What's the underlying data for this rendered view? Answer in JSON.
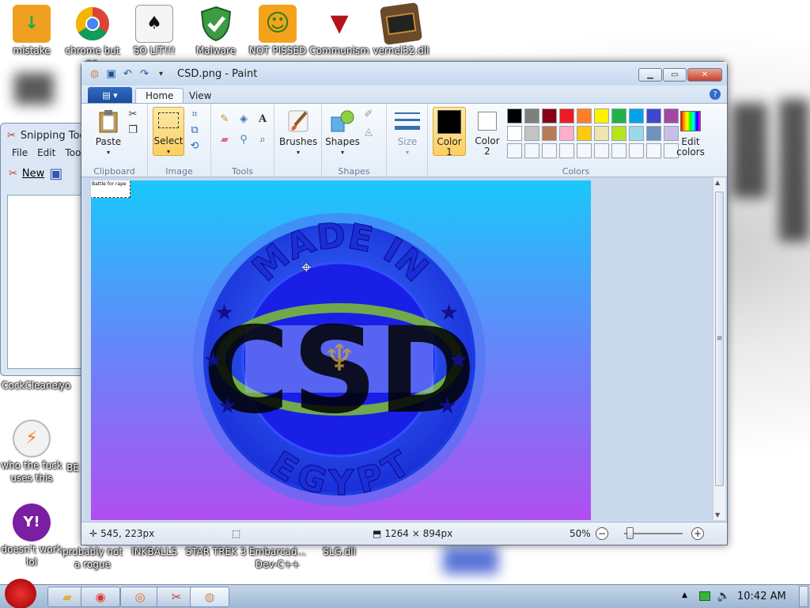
{
  "desktop": {
    "icons": [
      {
        "label": "mistake",
        "glyph": "↓",
        "bg": "#f0a020"
      },
      {
        "label": "chrome but no",
        "glyph": "◉",
        "bg": "#ffffff"
      },
      {
        "label": "SO LIT!!!",
        "glyph": "♠",
        "bg": "#eeeeee"
      },
      {
        "label": "Malware",
        "glyph": "✔",
        "bg": "#3c9c44"
      },
      {
        "label": "NOT PISSED",
        "glyph": "☺",
        "bg": "#7ec02c"
      },
      {
        "label": "Communism",
        "glyph": "▼",
        "bg": "#b3141b"
      },
      {
        "label": "vernel32.dll",
        "glyph": "▬",
        "bg": "#6a4a2a"
      },
      {
        "label": "CockCleaner",
        "glyph": "",
        "bg": "#d0d0d0"
      },
      {
        "label": "yo",
        "glyph": "",
        "bg": "#d0d0d0"
      },
      {
        "label": "who the fuck uses this",
        "glyph": "⚡",
        "bg": "#eeeeee"
      },
      {
        "label": "BE",
        "glyph": "",
        "bg": "#e3a020"
      },
      {
        "label": "doesn't work lol",
        "glyph": "Y!",
        "bg": "#7b1fa2"
      },
      {
        "label": "probably not a rogue",
        "glyph": "",
        "bg": "#5a7ec9"
      },
      {
        "label": "INKBALLS",
        "glyph": "",
        "bg": "#ffffff"
      },
      {
        "label": "STAR TREK 3",
        "glyph": "",
        "bg": "#ffffff"
      },
      {
        "label": "Embarcad... Dev-C++",
        "glyph": "",
        "bg": "#ffffff"
      },
      {
        "label": "SLG.dll",
        "glyph": "",
        "bg": "#ffffff"
      }
    ]
  },
  "snipping": {
    "title": "Snipping Too",
    "menu": [
      "File",
      "Edit",
      "Too"
    ],
    "new_label": "New"
  },
  "paint": {
    "title": "CSD.png - Paint",
    "qat": [
      "paint-icon",
      "save-icon",
      "undo-icon",
      "redo-icon",
      "dropdown-icon"
    ],
    "tabs": {
      "file": "▤ ▾",
      "home": "Home",
      "view": "View"
    },
    "ribbon": {
      "clipboard": {
        "label": "Clipboard",
        "paste": "Paste"
      },
      "image": {
        "label": "Image",
        "select": "Select"
      },
      "tools": {
        "label": "Tools"
      },
      "brushes": "Brushes",
      "shapes": {
        "label": "Shapes",
        "btn": "Shapes"
      },
      "size": "Size",
      "colors": {
        "label": "Colors",
        "color1": "Color 1",
        "color2": "Color 2",
        "edit": "Edit colors"
      }
    },
    "palette_row1": [
      "#000000",
      "#7f7f7f",
      "#880015",
      "#ed1c24",
      "#ff7f27",
      "#fff200",
      "#22b14c",
      "#00a2e8",
      "#3f48cc",
      "#a349a4"
    ],
    "palette_row2": [
      "#ffffff",
      "#c3c3c3",
      "#b97a57",
      "#ffaec9",
      "#ffc90e",
      "#efe4b0",
      "#b5e61d",
      "#99d9ea",
      "#7092be",
      "#c8bfe7"
    ],
    "color1": "#000000",
    "color2": "#ffffff",
    "canvas": {
      "selection_text": "Battle for rape",
      "badge_top": "MADE IN",
      "badge_bottom": "EGYPT",
      "badge_center": "CSD"
    },
    "status": {
      "cursor": "545, 223px",
      "image_size": "1264 × 894px",
      "zoom": "50%"
    }
  },
  "taskbar": {
    "clock": "10:42 AM"
  }
}
